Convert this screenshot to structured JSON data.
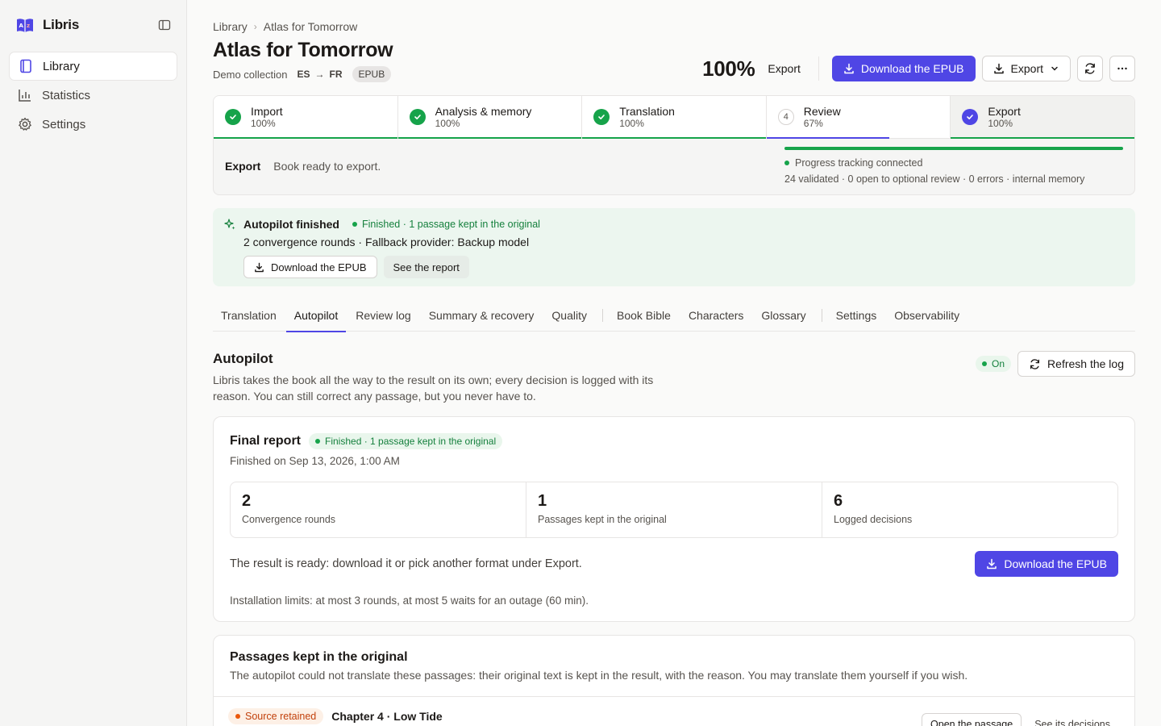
{
  "app": {
    "name": "Libris"
  },
  "sidebar": {
    "items": [
      {
        "label": "Library",
        "icon": "book-icon",
        "active": true
      },
      {
        "label": "Statistics",
        "icon": "bar-chart-icon",
        "active": false
      },
      {
        "label": "Settings",
        "icon": "gear-icon",
        "active": false
      }
    ]
  },
  "breadcrumb": {
    "root": "Library",
    "current": "Atlas for Tomorrow"
  },
  "book": {
    "title": "Atlas for Tomorrow",
    "collection": "Demo collection",
    "source_lang": "ES",
    "target_lang": "FR",
    "format": "EPUB"
  },
  "header": {
    "progress": "100%",
    "progress_label": "Export",
    "download_label": "Download the EPUB",
    "export_label": "Export"
  },
  "steps": [
    {
      "name": "Import",
      "pct": "100%",
      "status": "done",
      "marker": ""
    },
    {
      "name": "Analysis & memory",
      "pct": "100%",
      "status": "done",
      "marker": ""
    },
    {
      "name": "Translation",
      "pct": "100%",
      "status": "done",
      "marker": ""
    },
    {
      "name": "Review",
      "pct": "67%",
      "status": "partial",
      "marker": "4",
      "progress": 0.67
    },
    {
      "name": "Export",
      "pct": "100%",
      "status": "current",
      "marker": ""
    }
  ],
  "stage": {
    "label": "Export",
    "message": "Book ready to export.",
    "progress": 1.0,
    "tracking": "Progress tracking connected",
    "stats": "24 validated · 0 open to optional review · 0 errors · internal memory"
  },
  "banner": {
    "title": "Autopilot finished",
    "status": "Finished · 1 passage kept in the original",
    "detail": "2 convergence rounds · Fallback provider: Backup model",
    "download_label": "Download the EPUB",
    "report_label": "See the report"
  },
  "tabs": {
    "group1": [
      "Translation",
      "Autopilot",
      "Review log",
      "Summary & recovery",
      "Quality"
    ],
    "group2": [
      "Book Bible",
      "Characters",
      "Glossary"
    ],
    "group3": [
      "Settings",
      "Observability"
    ],
    "active": "Autopilot"
  },
  "autopilot": {
    "title": "Autopilot",
    "description": "Libris takes the book all the way to the result on its own; every decision is logged with its reason. You can still correct any passage, but you never have to.",
    "state": "On",
    "refresh_label": "Refresh the log"
  },
  "report": {
    "title": "Final report",
    "status": "Finished · 1 passage kept in the original",
    "finished_on": "Finished on Sep 13, 2026, 1:00 AM",
    "stats": [
      {
        "value": "2",
        "label": "Convergence rounds"
      },
      {
        "value": "1",
        "label": "Passages kept in the original"
      },
      {
        "value": "6",
        "label": "Logged decisions"
      }
    ],
    "ready_text": "The result is ready: download it or pick another format under Export.",
    "download_label": "Download the EPUB",
    "limits": "Installation limits: at most 3 rounds, at most 5 waits for an outage (60 min)."
  },
  "kept": {
    "title": "Passages kept in the original",
    "description": "The autopilot could not translate these passages: their original text is kept in the result, with the reason. You may translate them yourself if you wish.",
    "items": [
      {
        "badge": "Source retained",
        "chapter": "Chapter 4 · Low Tide",
        "open_label": "Open the passage",
        "decisions_label": "See its decisions"
      }
    ]
  },
  "colors": {
    "accent": "#4f46e5",
    "success": "#16a34a",
    "warning": "#ea580c"
  }
}
